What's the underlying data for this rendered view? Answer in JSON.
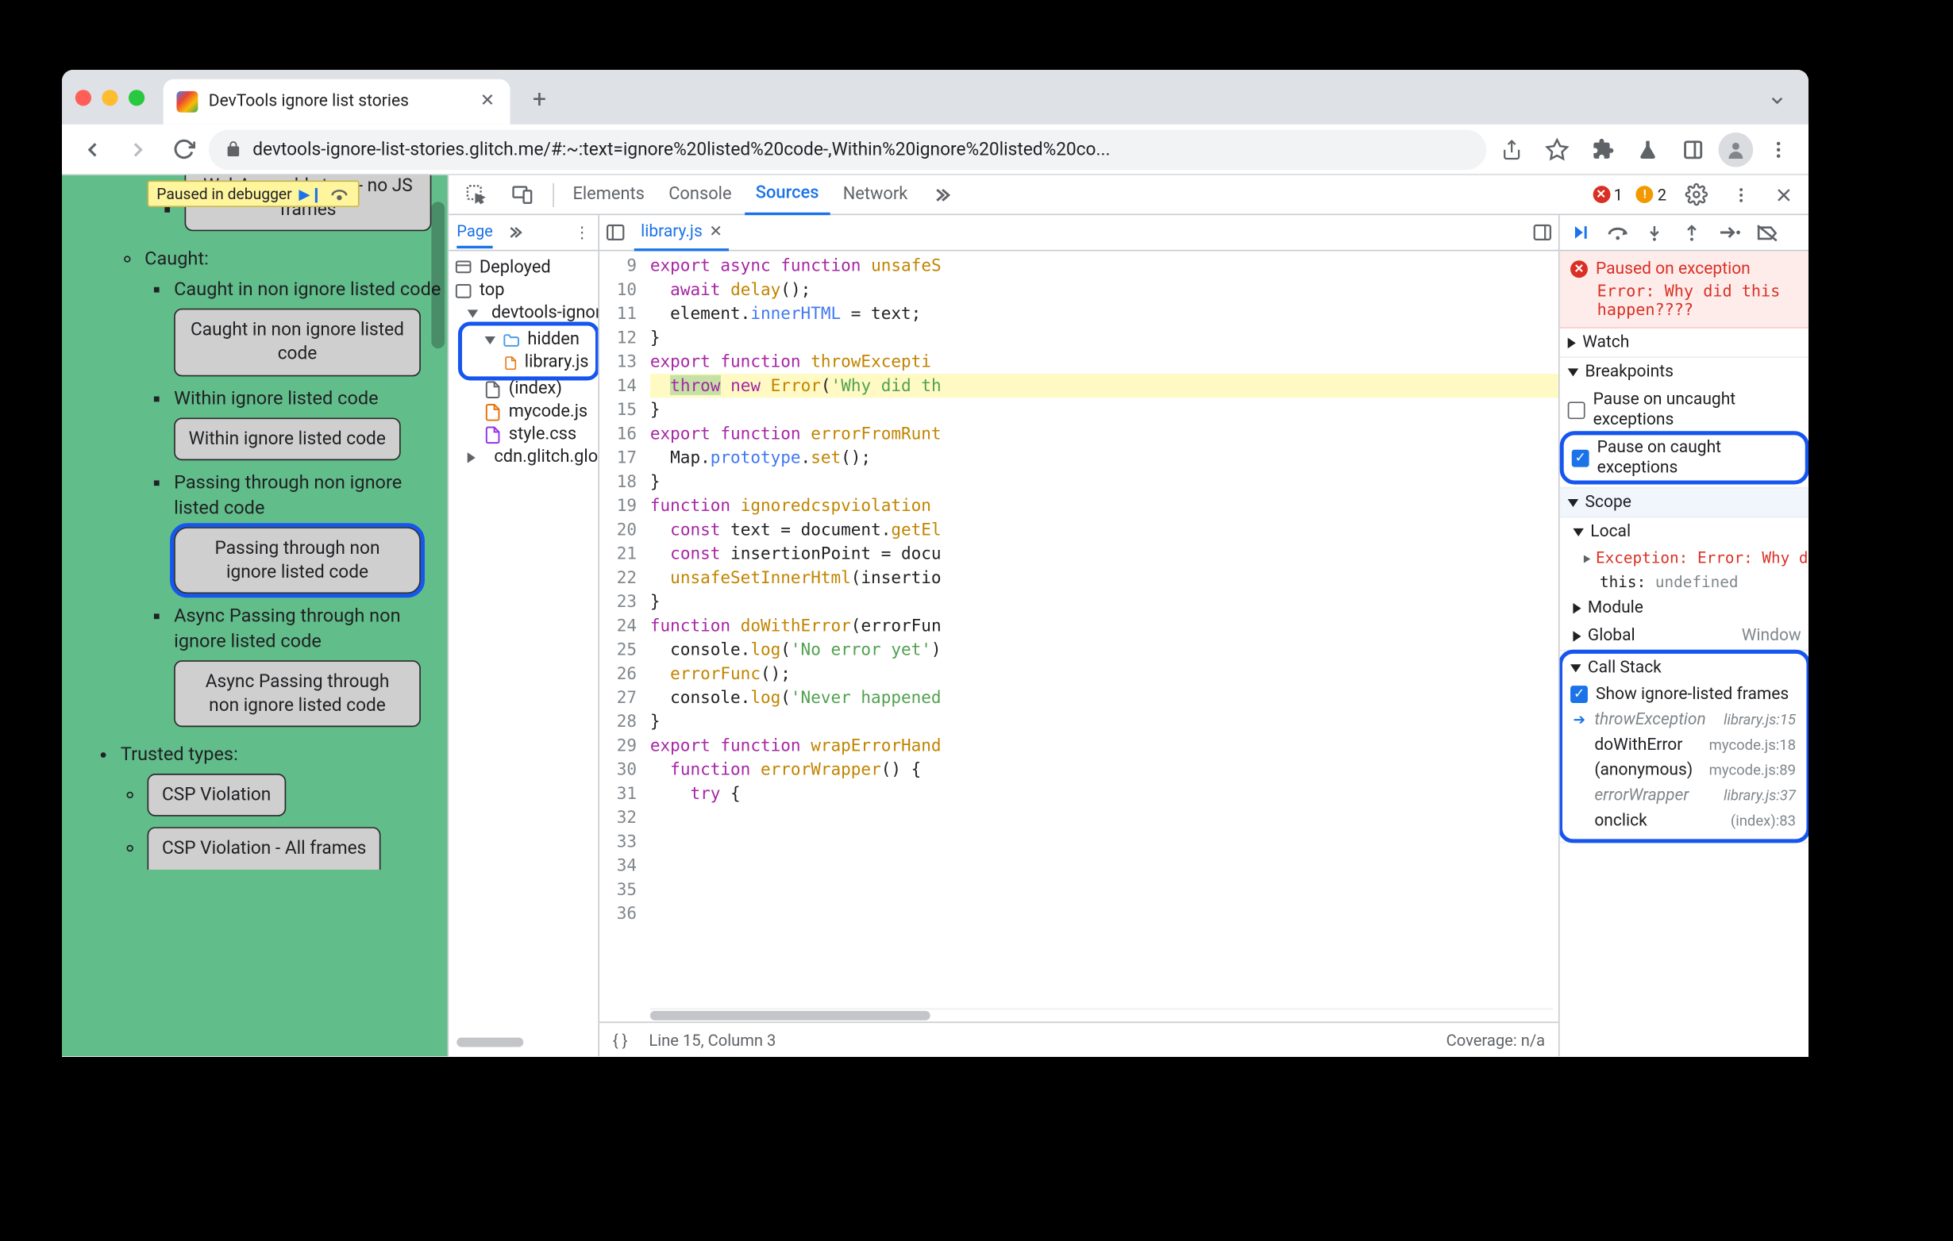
{
  "tab": {
    "title": "DevTools ignore list stories"
  },
  "toolbar": {
    "url": "devtools-ignore-list-stories.glitch.me/#:~:text=ignore%20listed%20code-,Within%20ignore%20listed%20co..."
  },
  "paused_badge": "Paused in debugger",
  "page": {
    "wasm_btn": "WebAssembly trap - no JS frames",
    "caught": "Caught:",
    "caught_non": "Caught in non ignore listed code",
    "caught_non_btn": "Caught in non ignore listed code",
    "within": "Within ignore listed code",
    "within_btn": "Within ignore listed code",
    "passing": "Passing through non ignore listed code",
    "passing_btn": "Passing through non ignore listed code",
    "async_passing": "Async Passing through non ignore listed code",
    "async_passing_btn": "Async Passing through non ignore listed code",
    "trusted": "Trusted types:",
    "csp": "CSP Violation",
    "csp_all": "CSP Violation - All frames"
  },
  "devtools_tabs": {
    "elements": "Elements",
    "console": "Console",
    "sources": "Sources",
    "network": "Network",
    "errors": "1",
    "warnings": "2"
  },
  "nav": {
    "page_tab": "Page",
    "deployed": "Deployed",
    "top": "top",
    "origin": "devtools-ignore",
    "hidden": "hidden",
    "library": "library.js",
    "index": "(index)",
    "mycode": "mycode.js",
    "style": "style.css",
    "cdn": "cdn.glitch.globa"
  },
  "code_tab": "library.js",
  "code": {
    "lines": [
      9,
      10,
      11,
      12,
      13,
      14,
      15,
      16,
      17,
      18,
      19,
      20,
      21,
      22,
      23,
      24,
      25,
      26,
      27,
      28,
      29,
      30,
      31,
      32,
      33,
      34,
      35,
      36
    ],
    "l9": "export async function unsafeS",
    "l10": "  await delay();",
    "l11": "  element.innerHTML = text;",
    "l12": "}",
    "l13": "",
    "l14": "export function throwExcepti",
    "l15a": "throw",
    "l15b": " new ",
    "l15c": "Error",
    "l15d": "('Why did th",
    "l16": "}",
    "l17": "",
    "l18": "export function errorFromRunt",
    "l19": "  Map.prototype.set();",
    "l20": "}",
    "l21": "",
    "l22": "function ignoredcspviolation",
    "l23": "  const text = document.getEl",
    "l24": "  const insertionPoint = docu",
    "l25": "  unsafeSetInnerHtml(insertio",
    "l26": "}",
    "l27": "",
    "l28": "function doWithError(errorFun",
    "l29": "  console.log('No error yet')",
    "l30": "  errorFunc();",
    "l31": "  console.log('Never happened",
    "l32": "}",
    "l33": "",
    "l34": "export function wrapErrorHand",
    "l35": "  function errorWrapper() {",
    "l36": "    try {"
  },
  "status": {
    "line": "Line 15, Column 3",
    "coverage": "Coverage: n/a"
  },
  "pause": {
    "title": "Paused on exception",
    "msg": "Error: Why did this happen????"
  },
  "sections": {
    "watch": "Watch",
    "breakpoints": "Breakpoints",
    "uncaught": "Pause on uncaught exceptions",
    "caught": "Pause on caught exceptions",
    "scope": "Scope",
    "local": "Local",
    "exception": "Exception: Error: Why did t",
    "this": "this: ",
    "thisval": "undefined",
    "module": "Module",
    "global": "Global",
    "window": "Window",
    "callstack": "Call Stack",
    "show_ign": "Show ignore-listed frames"
  },
  "callstack": [
    {
      "fn": "throwException",
      "loc": "library.js:15",
      "ignored": true,
      "current": true
    },
    {
      "fn": "doWithError",
      "loc": "mycode.js:18",
      "ignored": false
    },
    {
      "fn": "(anonymous)",
      "loc": "mycode.js:89",
      "ignored": false
    },
    {
      "fn": "errorWrapper",
      "loc": "library.js:37",
      "ignored": true
    },
    {
      "fn": "onclick",
      "loc": "(index):83",
      "ignored": false
    }
  ]
}
